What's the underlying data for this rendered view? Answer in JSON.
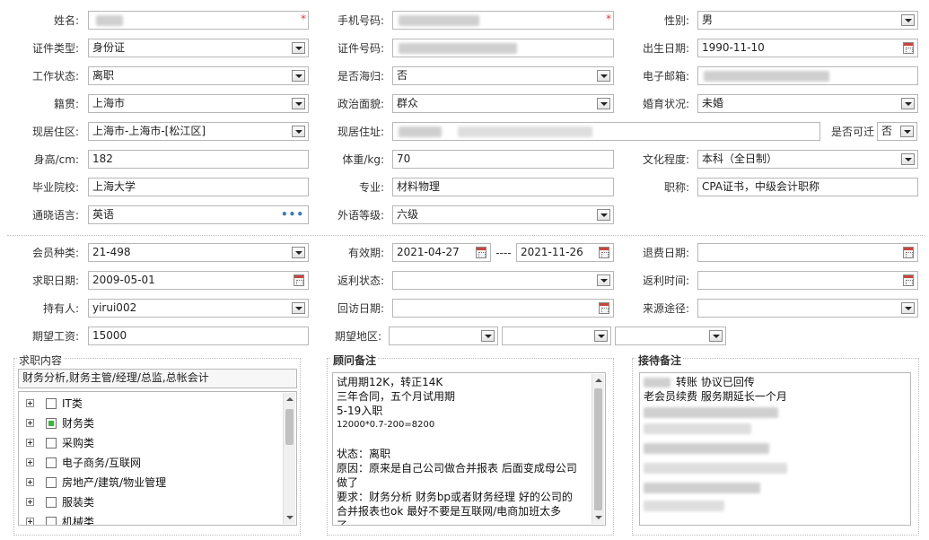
{
  "personal": {
    "name_label": "姓名:",
    "phone_label": "手机号码:",
    "gender_label": "性别:",
    "gender": "男",
    "id_type_label": "证件类型:",
    "id_type": "身份证",
    "id_no_label": "证件号码:",
    "birth_label": "出生日期:",
    "birth": "1990-11-10",
    "work_status_label": "工作状态:",
    "work_status": "离职",
    "returnee_label": "是否海归:",
    "returnee": "否",
    "email_label": "电子邮箱:",
    "native_label": "籍贯:",
    "native": "上海市",
    "political_label": "政治面貌:",
    "political": "群众",
    "marital_label": "婚育状况:",
    "marital": "未婚",
    "residence_area_label": "现居住区:",
    "residence_area": "上海市-上海市-[松江区]",
    "address_label": "现居住址:",
    "relocate_label": "是否可迁",
    "relocate": "否",
    "height_label": "身高/cm:",
    "height": "182",
    "weight_label": "体重/kg:",
    "weight": "70",
    "education_label": "文化程度:",
    "education": "本科（全日制）",
    "school_label": "毕业院校:",
    "school": "上海大学",
    "major_label": "专业:",
    "major": "材料物理",
    "title_label": "职称:",
    "title": "CPA证书，中级会计职称",
    "language_label": "通晓语言:",
    "language": "英语",
    "language_more": "•••",
    "fl_level_label": "外语等级:",
    "fl_level": "六级"
  },
  "membership": {
    "type_label": "会员种类:",
    "type": "21-498",
    "valid_label": "有效期:",
    "valid_from": "2021-04-27",
    "valid_sep": "----",
    "valid_to": "2021-11-26",
    "refund_date_label": "退费日期:",
    "job_date_label": "求职日期:",
    "job_date": "2009-05-01",
    "rebate_status_label": "返利状态:",
    "rebate_time_label": "返利时间:",
    "holder_label": "持有人:",
    "holder": "yirui002",
    "visit_date_label": "回访日期:",
    "source_label": "来源途径:",
    "salary_label": "期望工资:",
    "salary": "15000",
    "region_label": "期望地区:"
  },
  "job_content": {
    "title": "求职内容",
    "summary": "财务分析,财务主管/经理/总监,总帐会计",
    "items": [
      {
        "label": "IT类",
        "checked": false
      },
      {
        "label": "财务类",
        "checked": true
      },
      {
        "label": "采购类",
        "checked": false
      },
      {
        "label": "电子商务/互联网",
        "checked": false
      },
      {
        "label": "房地产/建筑/物业管理",
        "checked": false
      },
      {
        "label": "服装类",
        "checked": false
      },
      {
        "label": "机械类",
        "checked": false
      }
    ]
  },
  "consultant_notes": {
    "title": "顾问备注",
    "lines": [
      "试用期12K，转正14K",
      "三年合同，五个月试用期",
      "5-19入职",
      "12000*0.7-200=8200",
      "",
      "状态：离职",
      "原因：原来是自己公司做合并报表 后面变成母公司",
      "做了",
      "要求：财务分析 财务bp或者财务经理  好的公司的",
      "合并报表也ok  最好不要是互联网/电商加班太多",
      "了"
    ]
  },
  "reception_notes": {
    "title": "接待备注",
    "lines": [
      "转账 协议已回传",
      "老会员续费 服务期延长一个月"
    ]
  },
  "colors": {
    "required": "#e4393c",
    "checked": "#3bb53b",
    "more_dots": "#3b7ac0"
  }
}
